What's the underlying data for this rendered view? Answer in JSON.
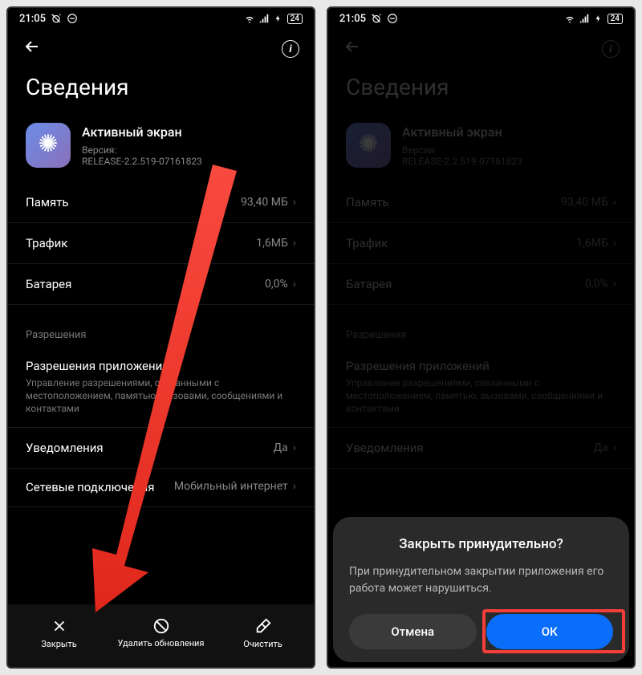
{
  "status": {
    "time": "21:05",
    "battery": "24"
  },
  "header": {
    "title": "Сведения"
  },
  "app": {
    "name": "Активный экран",
    "version_label": "Версия:",
    "version": "RELEASE-2.2.519-07161823"
  },
  "rows": {
    "memory": {
      "label": "Память",
      "value": "93,40 МБ"
    },
    "traffic": {
      "label": "Трафик",
      "value": "1,6МБ"
    },
    "battery": {
      "label": "Батарея",
      "value": "0,0%"
    }
  },
  "permissions": {
    "section": "Разрешения",
    "app_perms": {
      "label": "Разрешения приложений",
      "desc": "Управление разрешениями, связанными с местоположением, памятью, вызовами, сообщениями и контактами"
    },
    "notifications": {
      "label": "Уведомления",
      "value": "Да"
    },
    "network": {
      "label": "Сетевые подключения",
      "value": "Мобильный интернет"
    }
  },
  "bottom": {
    "close": "Закрыть",
    "uninstall_updates": "Удалить обновления",
    "clear": "Очистить"
  },
  "dialog": {
    "title": "Закрыть принудительно?",
    "text": "При принудительном закрытии приложения его работа может нарушиться.",
    "cancel": "Отмена",
    "ok": "ОК"
  }
}
